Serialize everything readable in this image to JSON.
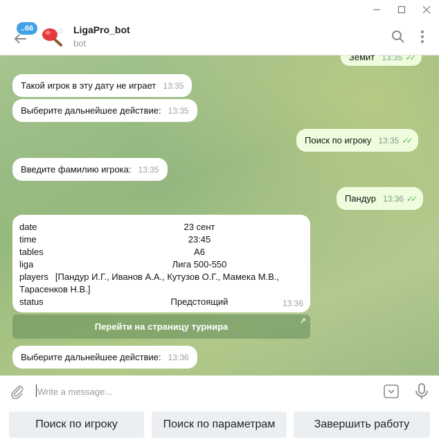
{
  "window": {
    "min_icon": "minimize-icon",
    "max_icon": "maximize-icon",
    "close_icon": "close-icon"
  },
  "header": {
    "unread_badge": "..66",
    "title": "LigaPro_bot",
    "subtitle": "bot"
  },
  "messages": [
    {
      "text": "Земит",
      "time": "13:35",
      "outgoing": true,
      "ticks": "✓✓"
    },
    {
      "text": "Такой игрок в эту дату не играет",
      "time": "13:35",
      "outgoing": false
    },
    {
      "text": "Выберите дальнейшее действие:",
      "time": "13:35",
      "outgoing": false
    },
    {
      "text": "Поиск по игроку",
      "time": "13:35",
      "outgoing": true,
      "ticks": "✓✓"
    },
    {
      "text": "Введите фамилию игрока:",
      "time": "13:35",
      "outgoing": false
    },
    {
      "text": "Пандур",
      "time": "13:36",
      "outgoing": true,
      "ticks": "✓✓"
    }
  ],
  "card": {
    "rows": [
      {
        "key": "date",
        "value": "23 сент"
      },
      {
        "key": "time",
        "value": "23:45"
      },
      {
        "key": "tables",
        "value": "A6"
      },
      {
        "key": "liga",
        "value": "Лига 500-550"
      }
    ],
    "players_key": "players",
    "players_value": "[Пандур И.Г., Иванов А.А., Кутузов О.Г., Мамека М.В., Тарасенков Н.В.]",
    "status_key": "status",
    "status_value": "Предстоящий",
    "time": "13:36"
  },
  "inline_button": {
    "label": "Перейти на страницу турнира",
    "arrow": "↗"
  },
  "last_message": {
    "text": "Выберите дальнейшее действие:",
    "time": "13:36"
  },
  "composer": {
    "placeholder": "Write a message..."
  },
  "keyboard": [
    "Поиск по игроку",
    "Поиск по параметрам",
    "Завершить работу"
  ]
}
